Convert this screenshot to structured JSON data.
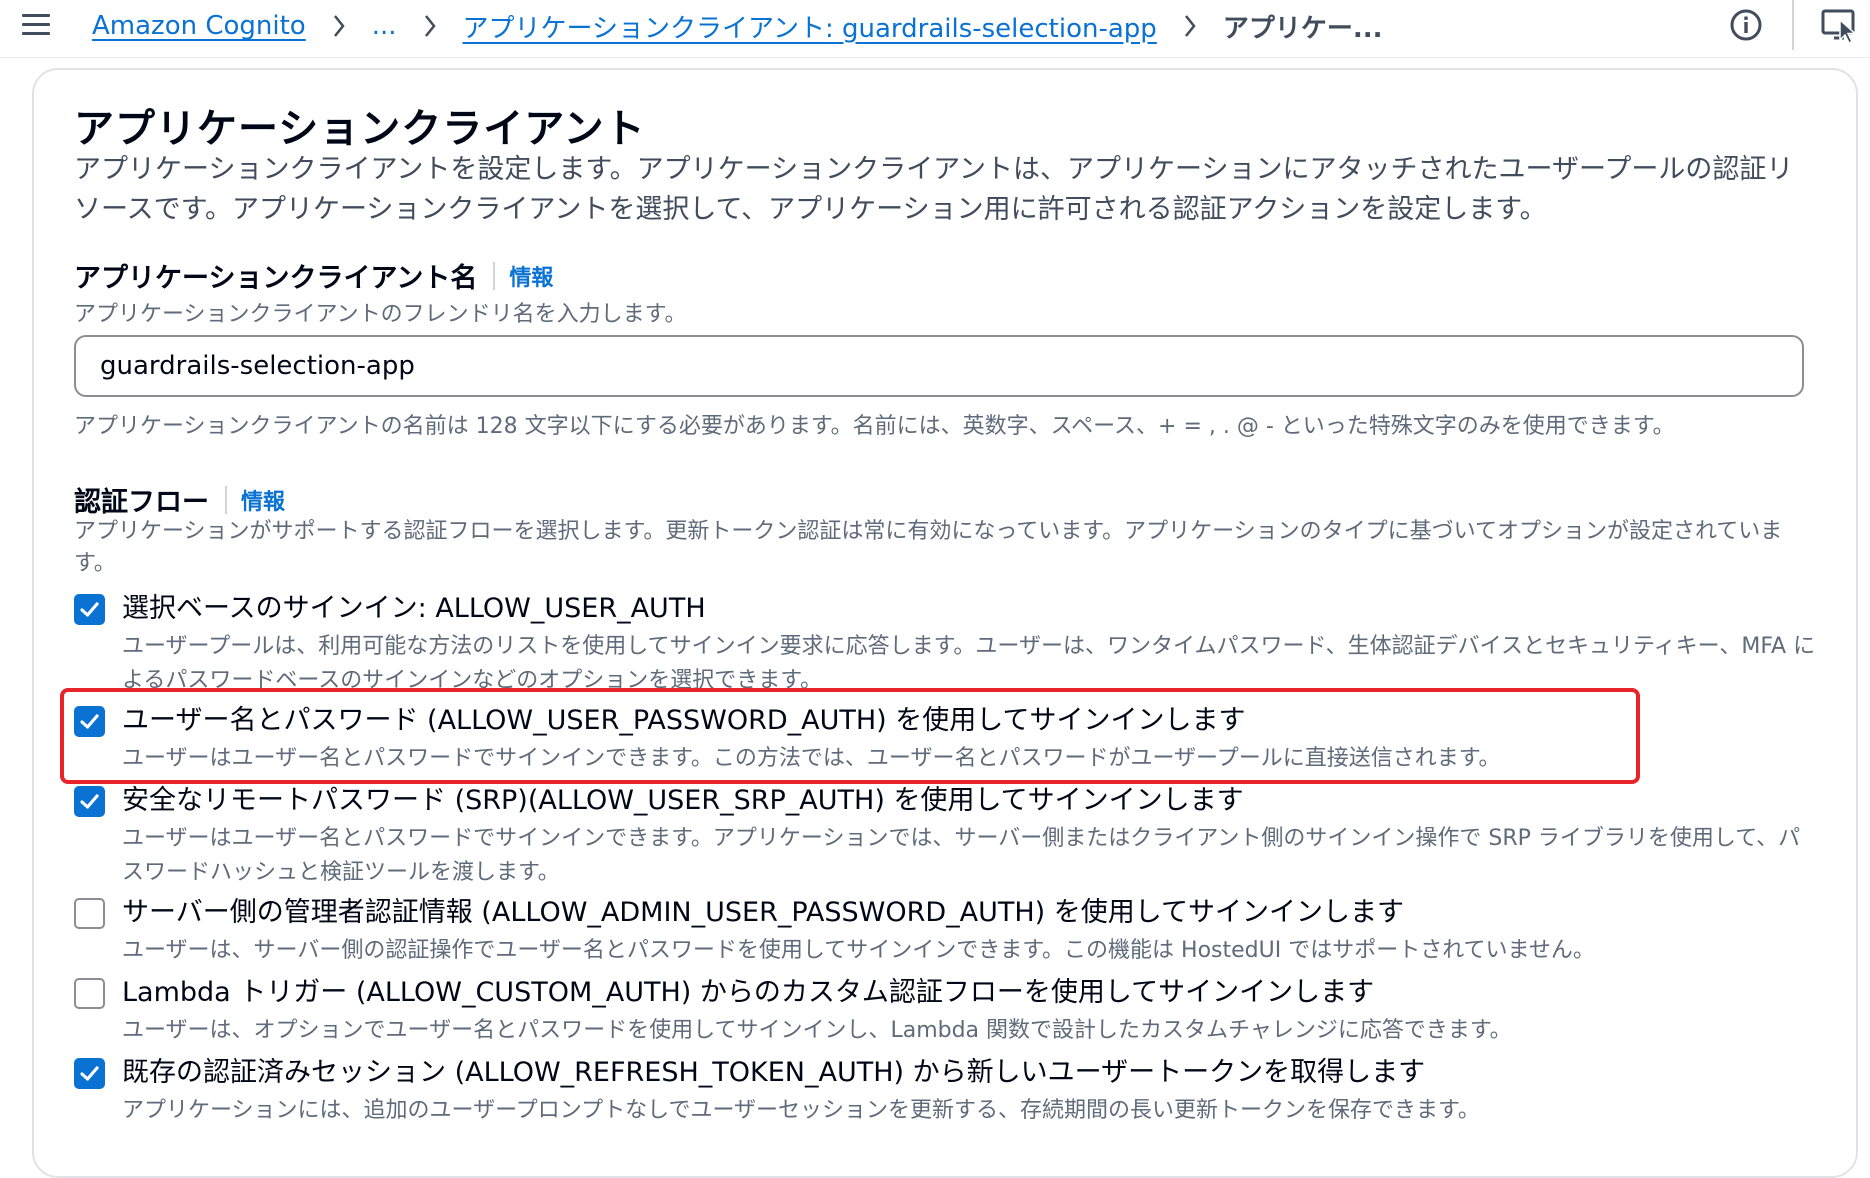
{
  "breadcrumb": {
    "items": [
      {
        "label": "Amazon Cognito"
      },
      {
        "label": "..."
      },
      {
        "label": "アプリケーションクライアント: guardrails-selection-app"
      }
    ],
    "current": "アプリケー..."
  },
  "panel": {
    "title": "アプリケーションクライアント",
    "description": "アプリケーションクライアントを設定します。アプリケーションクライアントは、アプリケーションにアタッチされたユーザープールの認証リソースです。アプリケーションクライアントを選択して、アプリケーション用に許可される認証アクションを設定します。"
  },
  "client_name": {
    "label": "アプリケーションクライアント名",
    "info": "情報",
    "description": "アプリケーションクライアントのフレンドリ名を入力します。",
    "value": "guardrails-selection-app",
    "constraint": "アプリケーションクライアントの名前は 128 文字以下にする必要があります。名前には、英数字、スペース、+ = , . @ - といった特殊文字のみを使用できます。"
  },
  "auth_flows": {
    "label": "認証フロー",
    "info": "情報",
    "description": "アプリケーションがサポートする認証フローを選択します。更新トークン認証は常に有効になっています。アプリケーションのタイプに基づいてオプションが設定されています。",
    "options": [
      {
        "label": "選択ベースのサインイン: ALLOW_USER_AUTH",
        "description": "ユーザープールは、利用可能な方法のリストを使用してサインイン要求に応答します。ユーザーは、ワンタイムパスワード、生体認証デバイスとセキュリティキー、MFA によるパスワードベースのサインインなどのオプションを選択できます。",
        "checked": true
      },
      {
        "label": "ユーザー名とパスワード (ALLOW_USER_PASSWORD_AUTH) を使用してサインインします",
        "description": "ユーザーはユーザー名とパスワードでサインインできます。この方法では、ユーザー名とパスワードがユーザープールに直接送信されます。",
        "checked": true,
        "highlighted": true
      },
      {
        "label": "安全なリモートパスワード (SRP)(ALLOW_USER_SRP_AUTH) を使用してサインインします",
        "description": "ユーザーはユーザー名とパスワードでサインインできます。アプリケーションでは、サーバー側またはクライアント側のサインイン操作で SRP ライブラリを使用して、パスワードハッシュと検証ツールを渡します。",
        "checked": true
      },
      {
        "label": "サーバー側の管理者認証情報 (ALLOW_ADMIN_USER_PASSWORD_AUTH) を使用してサインインします",
        "description": "ユーザーは、サーバー側の認証操作でユーザー名とパスワードを使用してサインインできます。この機能は HostedUI ではサポートされていません。",
        "checked": false
      },
      {
        "label": "Lambda トリガー (ALLOW_CUSTOM_AUTH) からのカスタム認証フローを使用してサインインします",
        "description": "ユーザーは、オプションでユーザー名とパスワードを使用してサインインし、Lambda 関数で設計したカスタムチャレンジに応答できます。",
        "checked": false
      },
      {
        "label": "既存の認証済みセッション (ALLOW_REFRESH_TOKEN_AUTH) から新しいユーザートークンを取得します",
        "description": "アプリケーションには、追加のユーザープロンプトなしでユーザーセッションを更新する、存続期間の長い更新トークンを保存できます。",
        "checked": true
      }
    ]
  },
  "colors": {
    "link": "#0972d3",
    "checkbox_checked": "#0972d3",
    "highlight": "#e8232a",
    "text_primary": "#000716",
    "text_secondary": "#5f6b7a"
  },
  "icons": {
    "menu": "hamburger-icon",
    "separator": "chevron-right-icon",
    "info": "info-circle-icon",
    "screen": "screen-cursor-icon",
    "check": "checkmark-icon"
  }
}
